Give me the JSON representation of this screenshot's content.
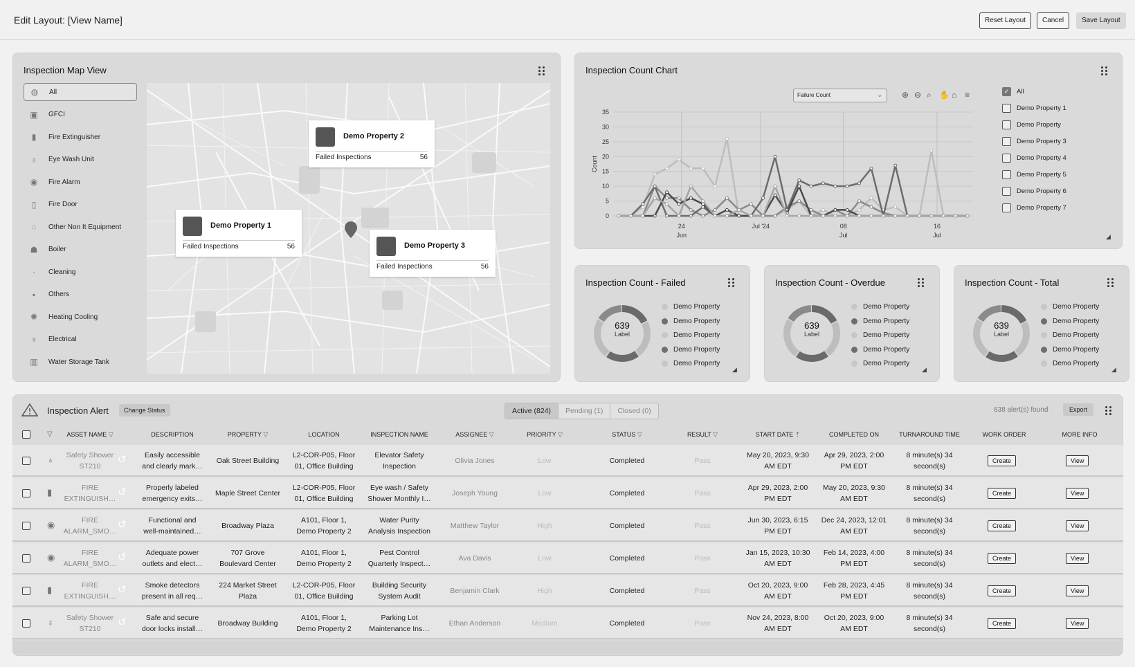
{
  "header": {
    "title": "Edit Layout: [View Name]",
    "reset": "Reset Layout",
    "cancel": "Cancel",
    "save": "Save Layout"
  },
  "map_card": {
    "title": "Inspection Map View",
    "filters": [
      "All",
      "GFCI",
      "Fire Extinguisher",
      "Eye Wash Unit",
      "Fire Alarm",
      "Fire Door",
      "Other Non It Equipment",
      "Boiler",
      "Cleaning",
      "Others",
      "Heating Cooling",
      "Electrical",
      "Water Storage Tank"
    ],
    "properties": [
      {
        "name": "Demo Property 2",
        "label": "Failed Inspections",
        "value": "56"
      },
      {
        "name": "Demo Property 1",
        "label": "Failed Inspections",
        "value": "56"
      },
      {
        "name": "Demo Property 3",
        "label": "Failed Inspections",
        "value": "56"
      }
    ]
  },
  "chart_card": {
    "title": "Inspection Count Chart",
    "dropdown": "Failure Count",
    "legend": [
      "All",
      "Demo Property 1",
      "Demo Property",
      "Demo Property 3",
      "Demo Property 4",
      "Demo Property 5",
      "Demo Property 6",
      "Demo Property 7"
    ]
  },
  "chart_data": {
    "type": "line",
    "ylabel": "Count",
    "ylim": [
      0,
      35
    ],
    "yticks": [
      "0",
      "5",
      "10",
      "15",
      "20",
      "25",
      "30",
      "35"
    ],
    "xticks": [
      {
        "top": "24",
        "bottom": "Jun"
      },
      {
        "top": "Jul '24",
        "bottom": ""
      },
      {
        "top": "08",
        "bottom": "Jul"
      },
      {
        "top": "16",
        "bottom": "Jul"
      }
    ],
    "n": 30,
    "series": [
      {
        "color": "#bdbdbd",
        "values": [
          0,
          0,
          3,
          14,
          16,
          19,
          16,
          16,
          10,
          26,
          0,
          0,
          0,
          0,
          2,
          5,
          0,
          2,
          0,
          0,
          2,
          6,
          2,
          3,
          0,
          0,
          22,
          0,
          0,
          0
        ]
      },
      {
        "color": "#8a8a8a",
        "values": [
          0,
          0,
          0,
          10,
          6,
          6,
          2,
          0,
          2,
          6,
          2,
          4,
          0,
          0,
          3,
          5,
          2,
          0,
          2,
          0,
          5,
          3,
          1,
          0,
          0,
          0,
          0,
          0,
          0,
          0
        ]
      },
      {
        "color": "#6c6c6c",
        "values": [
          0,
          0,
          4,
          10,
          0,
          0,
          0,
          3,
          0,
          0,
          0,
          0,
          6,
          20,
          2,
          12,
          10,
          11,
          10,
          10,
          11,
          16,
          0,
          17,
          0,
          0,
          0,
          0,
          0,
          0
        ]
      },
      {
        "color": "#4a4a4a",
        "values": [
          0,
          0,
          0,
          0,
          8,
          4,
          6,
          4,
          0,
          2,
          0,
          0,
          0,
          7,
          1,
          10,
          0,
          0,
          2,
          2,
          0,
          0,
          0,
          0,
          0,
          0,
          0,
          0,
          0,
          0
        ]
      },
      {
        "color": "#a5a5a5",
        "values": [
          0,
          0,
          0,
          6,
          4,
          0,
          10,
          5,
          0,
          0,
          2,
          0,
          0,
          10,
          0,
          0,
          0,
          0,
          0,
          0,
          0,
          0,
          0,
          0,
          0,
          0,
          0,
          0,
          0,
          0
        ]
      }
    ]
  },
  "donuts": [
    {
      "title": "Inspection Count - Failed",
      "value": "639",
      "label": "Label",
      "legend": [
        "Demo Property",
        "Demo Property",
        "Demo Property",
        "Demo Property",
        "Demo Property"
      ]
    },
    {
      "title": "Inspection Count - Overdue",
      "value": "639",
      "label": "Label",
      "legend": [
        "Demo Property",
        "Demo Property",
        "Demo Property",
        "Demo Property",
        "Demo Property"
      ]
    },
    {
      "title": "Inspection Count - Total",
      "value": "639",
      "label": "Label",
      "legend": [
        "Demo Property",
        "Demo Property",
        "Demo Property",
        "Demo Property",
        "Demo Property"
      ]
    }
  ],
  "donut_colors": [
    "#c7c7c7",
    "#6e6e6e",
    "#c7c7c7",
    "#6e6e6e",
    "#c7c7c7"
  ],
  "alert": {
    "title": "Inspection Alert",
    "change_status": "Change Status",
    "tabs": [
      "Active (824)",
      "Pending (1)",
      "Closed (0)"
    ],
    "found": "638 alert(s) found",
    "export": "Export",
    "columns": [
      "ASSET NAME",
      "DESCRIPTION",
      "PROPERTY",
      "LOCATION",
      "INSPECTION NAME",
      "ASSIGNEE",
      "PRIORITY",
      "STATUS",
      "RESULT",
      "START DATE",
      "COMPLETED ON",
      "TURNAROUND TIME",
      "WORK ORDER",
      "MORE INFO"
    ],
    "rows": [
      {
        "asset": [
          "Safety Shower",
          "ST210"
        ],
        "desc": [
          "Easily accessible",
          "and clearly mark…"
        ],
        "prop": [
          "Oak Street Building"
        ],
        "loc": [
          "L2-COR-P05, Floor",
          "01, Office Building"
        ],
        "insp": [
          "Elevator Safety",
          "Inspection"
        ],
        "assignee": "Olivia Jones",
        "priority": "Low",
        "status": "Completed",
        "result": "Pass",
        "start": [
          "May 20, 2023, 9:30",
          "AM EDT"
        ],
        "completed": [
          "Apr 29, 2023, 2:00",
          "PM EDT"
        ],
        "tat": [
          "8 minute(s) 34",
          "second(s)"
        ],
        "wo": "Create",
        "more": "View"
      },
      {
        "asset": [
          "FIRE",
          "EXTINGUISH…"
        ],
        "desc": [
          "Properly labeled",
          "emergency exits…"
        ],
        "prop": [
          "Maple Street Center"
        ],
        "loc": [
          "L2-COR-P05, Floor",
          "01, Office Building"
        ],
        "insp": [
          "Eye wash / Safety",
          "Shower Monthly I…"
        ],
        "assignee": "Joseph Young",
        "priority": "Low",
        "status": "Completed",
        "result": "Pass",
        "start": [
          "Apr 29, 2023, 2:00",
          "PM EDT"
        ],
        "completed": [
          "May 20, 2023, 9:30",
          "AM EDT"
        ],
        "tat": [
          "8 minute(s) 34",
          "second(s)"
        ],
        "wo": "Create",
        "more": "View"
      },
      {
        "asset": [
          "FIRE",
          "ALARM_SMO…"
        ],
        "desc": [
          "Functional and",
          "well-maintained…"
        ],
        "prop": [
          "Broadway Plaza"
        ],
        "loc": [
          "A101, Floor 1,",
          "Demo Property 2"
        ],
        "insp": [
          "Water Purity",
          "Analysis Inspection"
        ],
        "assignee": "Matthew Taylor",
        "priority": "High",
        "status": "Completed",
        "result": "Pass",
        "start": [
          "Jun 30, 2023, 6:15",
          "PM EDT"
        ],
        "completed": [
          "Dec 24, 2023, 12:01",
          "AM EDT"
        ],
        "tat": [
          "8 minute(s) 34",
          "second(s)"
        ],
        "wo": "Create",
        "more": "View"
      },
      {
        "asset": [
          "FIRE",
          "ALARM_SMO…"
        ],
        "desc": [
          "Adequate power",
          "outlets and elect…"
        ],
        "prop": [
          "707 Grove",
          "Boulevard Center"
        ],
        "loc": [
          "A101, Floor 1,",
          "Demo Property 2"
        ],
        "insp": [
          "Pest Control",
          "Quarterly Inspect…"
        ],
        "assignee": "Ava Davis",
        "priority": "Low",
        "status": "Completed",
        "result": "Pass",
        "start": [
          "Jan 15, 2023, 10:30",
          "AM EDT"
        ],
        "completed": [
          "Feb 14, 2023, 4:00",
          "PM EDT"
        ],
        "tat": [
          "8 minute(s) 34",
          "second(s)"
        ],
        "wo": "Create",
        "more": "View"
      },
      {
        "asset": [
          "FIRE",
          "EXTINGUISH…"
        ],
        "desc": [
          "Smoke detectors",
          "present in all req…"
        ],
        "prop": [
          "224 Market Street",
          "Plaza"
        ],
        "loc": [
          "L2-COR-P05, Floor",
          "01, Office Building"
        ],
        "insp": [
          "Building Security",
          "System Audit"
        ],
        "assignee": "Benjamin Clark",
        "priority": "High",
        "status": "Completed",
        "result": "Pass",
        "start": [
          "Oct 20, 2023, 9:00",
          "AM EDT"
        ],
        "completed": [
          "Feb 28, 2023, 4:45",
          "PM EDT"
        ],
        "tat": [
          "8 minute(s) 34",
          "second(s)"
        ],
        "wo": "Create",
        "more": "View"
      },
      {
        "asset": [
          "Safety Shower",
          "ST210"
        ],
        "desc": [
          "Safe and secure",
          "door locks install…"
        ],
        "prop": [
          "Broadway Building"
        ],
        "loc": [
          "A101, Floor 1,",
          "Demo Property 2"
        ],
        "insp": [
          "Parking Lot",
          "Maintenance Ins…"
        ],
        "assignee": "Ethan Anderson",
        "priority": "Medium",
        "status": "Completed",
        "result": "Pass",
        "start": [
          "Nov 24, 2023, 8:00",
          "AM EDT"
        ],
        "completed": [
          "Oct 20, 2023, 9:00",
          "AM EDT"
        ],
        "tat": [
          "8 minute(s) 34",
          "second(s)"
        ],
        "wo": "Create",
        "more": "View"
      }
    ]
  }
}
